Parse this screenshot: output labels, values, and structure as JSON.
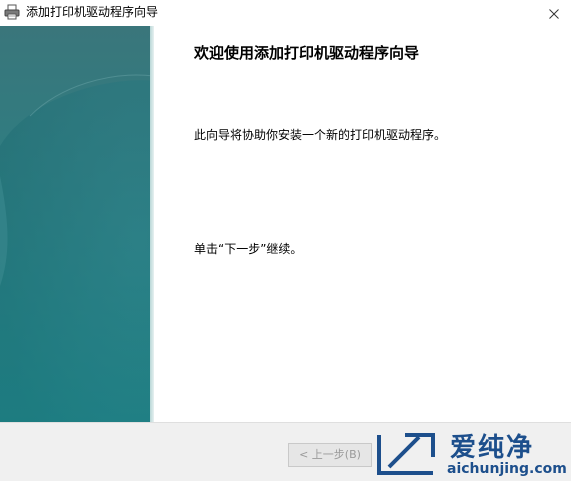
{
  "window": {
    "title": "添加打印机驱动程序向导",
    "icons": {
      "app_icon": "printer-icon",
      "close_icon": "close-icon"
    }
  },
  "content": {
    "heading": "欢迎使用添加打印机驱动程序向导",
    "description": "此向导将协助你安装一个新的打印机驱动程序。",
    "hint": "单击“下一步”继续。"
  },
  "footer": {
    "back_button_label": "< 上一步(B)",
    "back_button_state": "disabled"
  },
  "watermark": {
    "brand": "爱纯净",
    "url": "aichunjing.com",
    "color": "#1d4f8c"
  },
  "colors": {
    "banner_teal": "#2a7f84",
    "footer_bg": "#f0f0f0"
  }
}
